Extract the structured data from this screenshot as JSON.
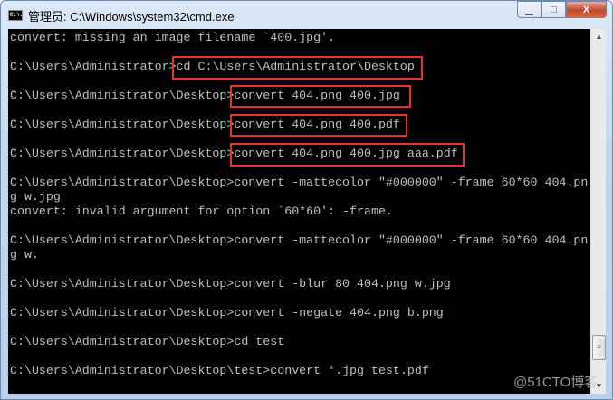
{
  "window": {
    "title": "管理员: C:\\Windows\\system32\\cmd.exe",
    "icon_text": "C:\\.",
    "min": "▁",
    "max": "□",
    "close": "X"
  },
  "console": {
    "lines": [
      "convert: missing an image filename `400.jpg'.",
      "",
      "C:\\Users\\Administrator>cd C:\\Users\\Administrator\\Desktop",
      "",
      "C:\\Users\\Administrator\\Desktop>convert 404.png 400.jpg",
      "",
      "C:\\Users\\Administrator\\Desktop>convert 404.png 400.pdf",
      "",
      "C:\\Users\\Administrator\\Desktop>convert 404.png 400.jpg aaa.pdf",
      "",
      "C:\\Users\\Administrator\\Desktop>convert -mattecolor \"#000000\" -frame 60*60 404.pn",
      "g w.jpg",
      "convert: invalid argument for option `60*60': -frame.",
      "",
      "C:\\Users\\Administrator\\Desktop>convert -mattecolor \"#000000\" -frame 60*60 404.pn",
      "g w.",
      "",
      "C:\\Users\\Administrator\\Desktop>convert -blur 80 404.png w.jpg",
      "",
      "C:\\Users\\Administrator\\Desktop>convert -negate 404.png b.png",
      "",
      "C:\\Users\\Administrator\\Desktop>cd test",
      "",
      "C:\\Users\\Administrator\\Desktop\\test>convert *.jpg test.pdf"
    ]
  },
  "scrollbar": {
    "up": "▲",
    "down": "▼",
    "grip": "≡"
  },
  "watermark": "@51CTO博客",
  "colors": {
    "highlight": "#e8312f",
    "text": "#c0c0c0"
  }
}
